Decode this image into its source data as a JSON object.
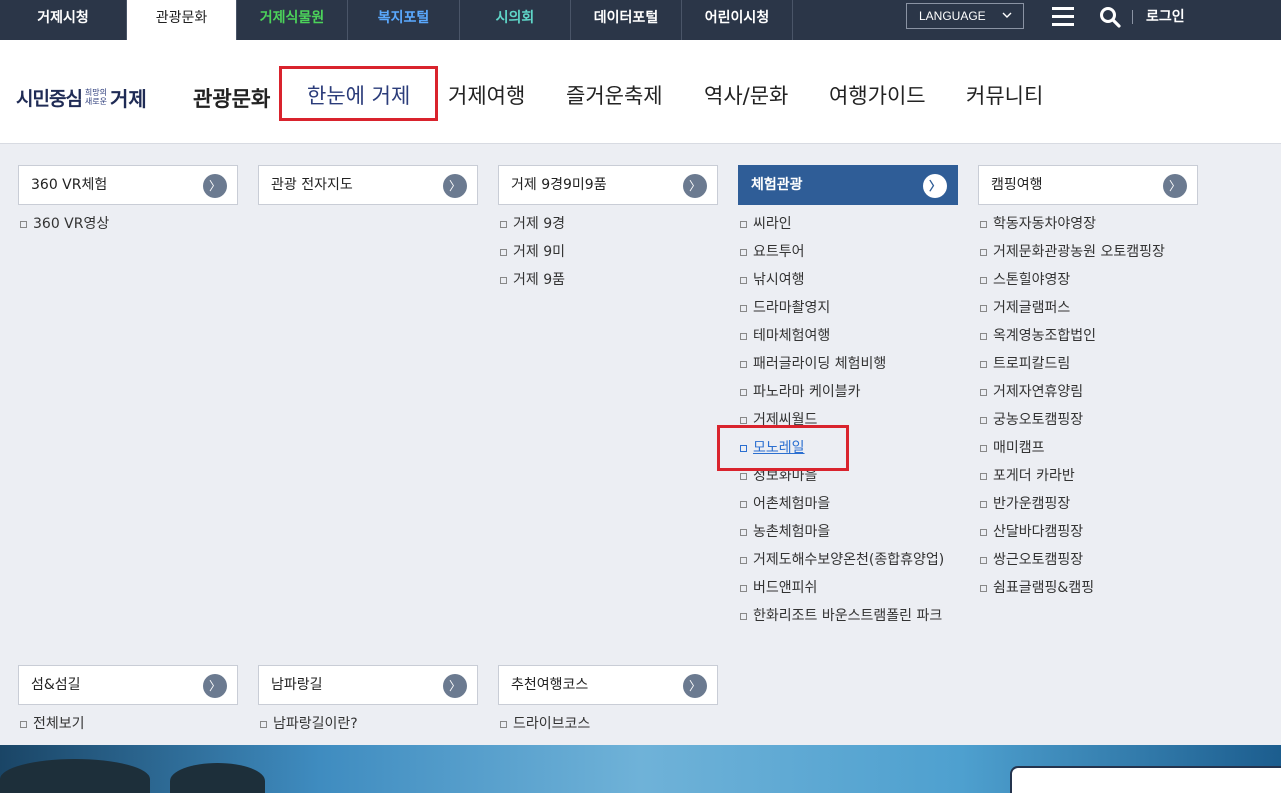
{
  "topbar": {
    "tabs": [
      {
        "label": "거제시청"
      },
      {
        "label": "관광문화"
      },
      {
        "label": "거제식물원"
      },
      {
        "label": "복지포털"
      },
      {
        "label": "시의회"
      },
      {
        "label": "데이터포털"
      },
      {
        "label": "어린이시청"
      }
    ],
    "language_label": "LANGUAGE",
    "login_label": "로그인"
  },
  "header": {
    "logo_main": "시민중심",
    "logo_small_1": "희망의",
    "logo_small_2": "새로운",
    "logo_city": "거제",
    "section_title": "관광문화",
    "gnb": [
      {
        "label": "한눈에 거제"
      },
      {
        "label": "거제여행"
      },
      {
        "label": "즐거운축제"
      },
      {
        "label": "역사/문화"
      },
      {
        "label": "여행가이드"
      },
      {
        "label": "커뮤니티"
      }
    ]
  },
  "megamenu": {
    "arrow_glyph": "〉",
    "col1": {
      "title": "360 VR체험",
      "items": [
        "360 VR영상"
      ]
    },
    "col2": {
      "title": "관광 전자지도",
      "items": []
    },
    "col3": {
      "title": "거제 9경9미9품",
      "items": [
        "거제 9경",
        "거제 9미",
        "거제 9품"
      ]
    },
    "col4": {
      "title": "체험관광",
      "items": [
        "씨라인",
        "요트투어",
        "낚시여행",
        "드라마촬영지",
        "테마체험여행",
        "패러글라이딩 체험비행",
        "파노라마 케이블카",
        "거제씨월드",
        "모노레일",
        "정보화마을",
        "어촌체험마을",
        "농촌체험마을",
        "거제도해수보양온천(종합휴양업)",
        "버드앤피쉬",
        "한화리조트 바운스트램폴린 파크"
      ]
    },
    "col5": {
      "title": "캠핑여행",
      "items": [
        "학동자동차야영장",
        "거제문화관광농원 오토캠핑장",
        "스톤힐야영장",
        "거제글램퍼스",
        "옥계영농조합법인",
        "트로피칼드림",
        "거제자연휴양림",
        "궁농오토캠핑장",
        "매미캠프",
        "포게더 카라반",
        "반가운캠핑장",
        "산달바다캠핑장",
        "쌍근오토캠핑장",
        "쉼표글램핑&캠핑"
      ]
    },
    "col6": {
      "title": "섬&섬길",
      "items": [
        "전체보기"
      ]
    },
    "col7": {
      "title": "남파랑길",
      "items": [
        "남파랑길이란?"
      ]
    },
    "col8": {
      "title": "추천여행코스",
      "items": [
        "드라이브코스"
      ]
    }
  },
  "colors": {
    "topbar": "#2b3648",
    "accent": "#2f5d97",
    "highlight": "#d9232d"
  }
}
